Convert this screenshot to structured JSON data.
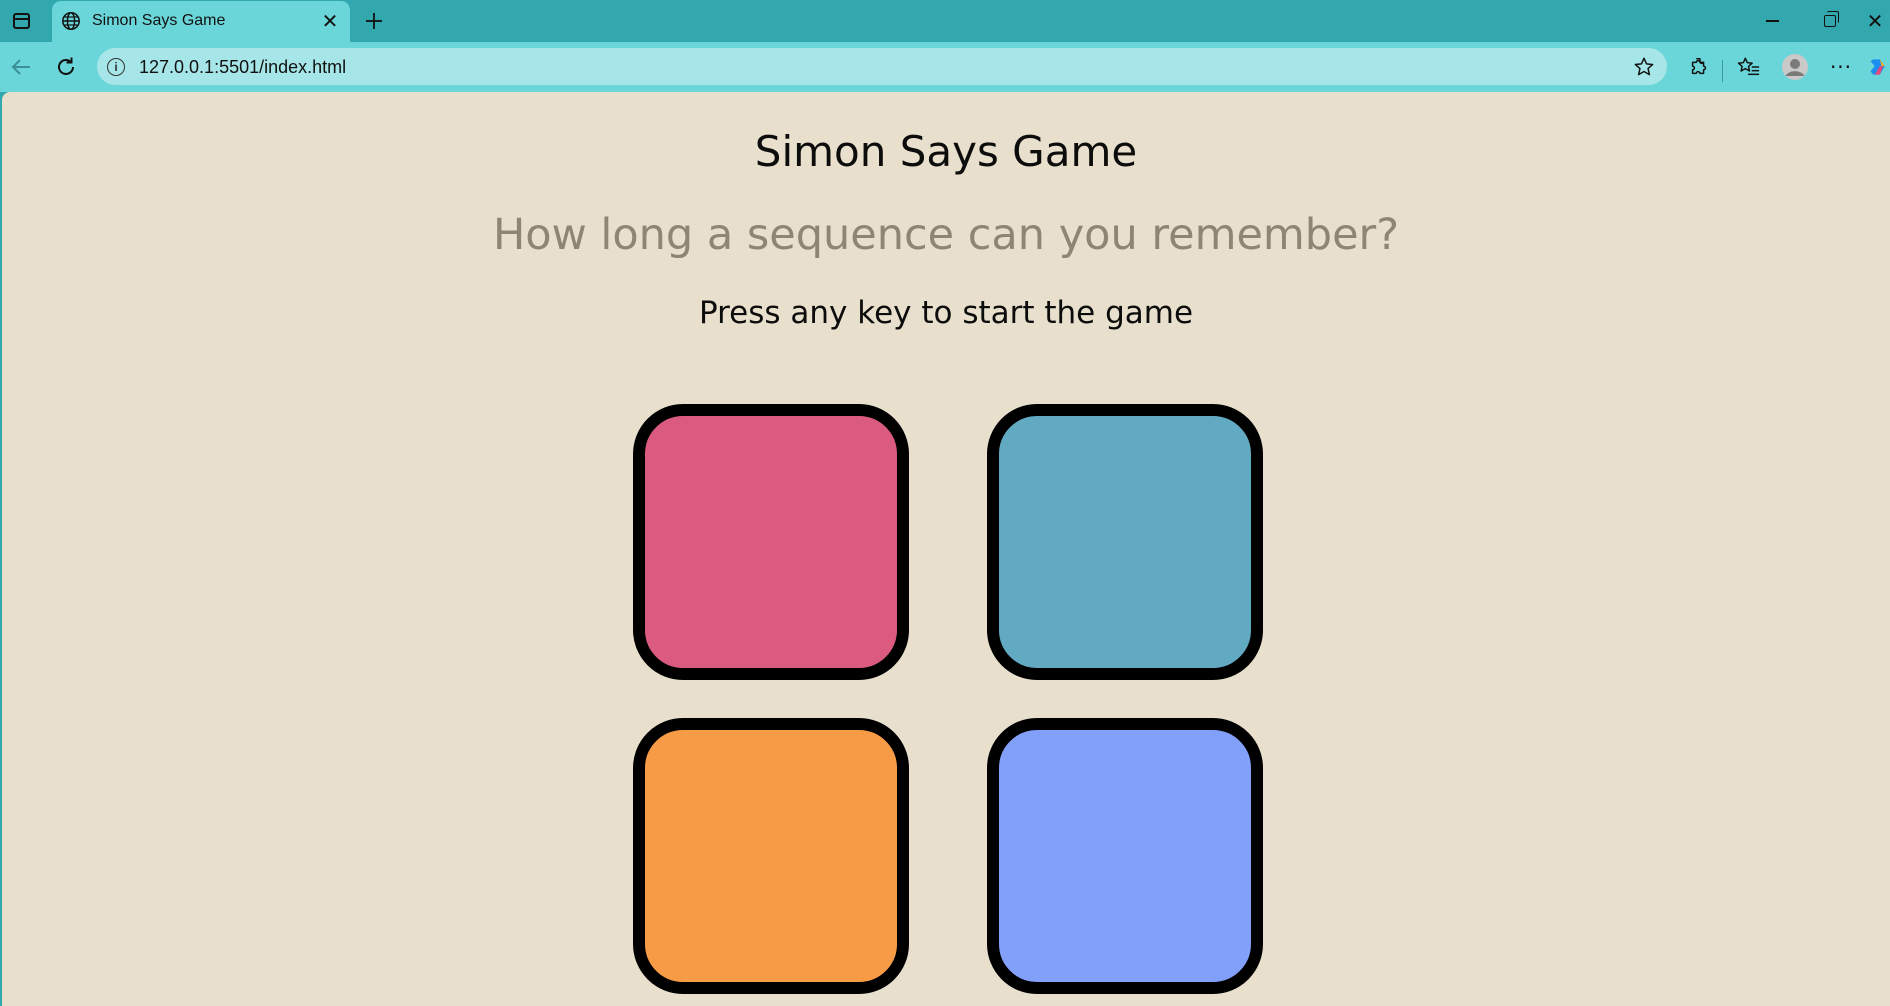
{
  "browser": {
    "tab": {
      "title": "Simon Says Game"
    },
    "address_bar": {
      "url": "127.0.0.1:5501/index.html"
    },
    "icons": {
      "tab_actions": "tab-actions-icon",
      "globe": "globe-icon",
      "close": "close-icon",
      "new_tab": "plus-icon",
      "back": "back-arrow-icon",
      "reload": "reload-icon",
      "site_info": "info-icon",
      "favorite": "star-icon",
      "extensions": "puzzle-icon",
      "favorites": "favorites-icon",
      "profile": "profile-icon",
      "more": "more-icon",
      "copilot": "copilot-icon"
    },
    "colors": {
      "frame": "#32a7ad",
      "toolbar": "#6bd6d9",
      "omnibox": "#a7e6e8"
    }
  },
  "game": {
    "title": "Simon Says Game",
    "subtitle": "How long a sequence can you remember?",
    "prompt": "Press any key to start the game",
    "background_color": "#e8e0cd",
    "pads": [
      {
        "name": "pink",
        "color": "#db5a80"
      },
      {
        "name": "teal",
        "color": "#62aac2"
      },
      {
        "name": "orange",
        "color": "#f89b47"
      },
      {
        "name": "blue",
        "color": "#829ffa"
      }
    ]
  }
}
